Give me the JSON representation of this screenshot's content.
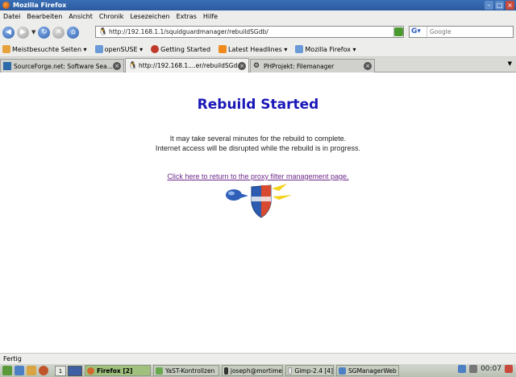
{
  "window": {
    "title": "Mozilla Firefox"
  },
  "menubar": {
    "items": [
      "Datei",
      "Bearbeiten",
      "Ansicht",
      "Chronik",
      "Lesezeichen",
      "Extras",
      "Hilfe"
    ]
  },
  "navbar": {
    "url": "http://192.168.1.1/squidguardmanager/rebuildSGdb/",
    "search_placeholder": "Google"
  },
  "bookmarks": [
    {
      "label": "Meistbesuchte Seiten",
      "icon": "folder-icon",
      "dropdown": true
    },
    {
      "label": "openSUSE",
      "icon": "folder-icon",
      "dropdown": true
    },
    {
      "label": "Getting Started",
      "icon": "firefox-icon",
      "dropdown": false
    },
    {
      "label": "Latest Headlines",
      "icon": "rss-icon",
      "dropdown": true
    },
    {
      "label": "Mozilla Firefox",
      "icon": "folder-icon",
      "dropdown": true
    }
  ],
  "tabs": [
    {
      "label": "SourceForge.net: Software Sea...",
      "active": false
    },
    {
      "label": "http://192.168.1....er/rebuildSGdb/",
      "active": true
    },
    {
      "label": "PHProjekt: Filemanager",
      "active": false
    }
  ],
  "page": {
    "heading": "Rebuild Started",
    "line1": "It may take several minutes for the rebuild to complete.",
    "line2": "Internet access will be disrupted while the rebuild is in progress.",
    "link": "Click here to return to the proxy filter management page."
  },
  "status": {
    "text": "Fertig"
  },
  "taskbar": {
    "workspace": "1",
    "tasks": [
      {
        "label": "Firefox [2]",
        "active": true
      },
      {
        "label": "YaST-Kontrollzen",
        "active": false
      },
      {
        "label": "joseph@mortime",
        "active": false
      },
      {
        "label": "Gimp-2.4 [4]",
        "active": false
      },
      {
        "label": "SGManagerWeb",
        "active": false
      }
    ],
    "clock": "00:07"
  }
}
